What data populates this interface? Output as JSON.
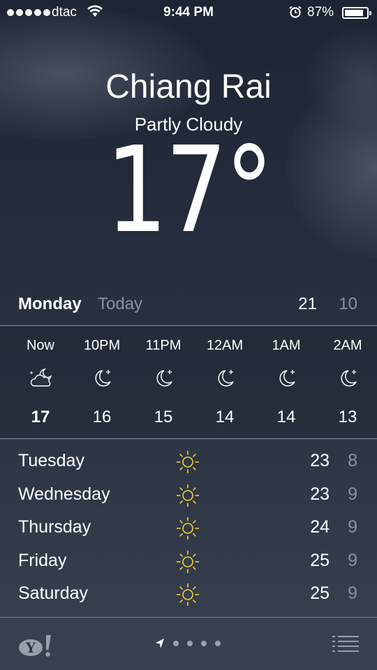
{
  "status_bar": {
    "carrier": "dtac",
    "time": "9:44 PM",
    "battery_percent": "87%",
    "battery_level": 0.87,
    "signal_bars": 5,
    "icons": [
      "wifi-icon",
      "alarm-icon",
      "battery-icon"
    ]
  },
  "location": {
    "city": "Chiang Rai",
    "condition": "Partly Cloudy",
    "temperature": "17",
    "degree_symbol": "°"
  },
  "today": {
    "day": "Monday",
    "label": "Today",
    "high": "21",
    "low": "10"
  },
  "hourly": [
    {
      "time": "Now",
      "icon": "partly-cloudy-night-icon",
      "temp": "17"
    },
    {
      "time": "10PM",
      "icon": "clear-night-icon",
      "temp": "16"
    },
    {
      "time": "11PM",
      "icon": "clear-night-icon",
      "temp": "15"
    },
    {
      "time": "12AM",
      "icon": "clear-night-icon",
      "temp": "14"
    },
    {
      "time": "1AM",
      "icon": "clear-night-icon",
      "temp": "14"
    },
    {
      "time": "2AM",
      "icon": "clear-night-icon",
      "temp": "13"
    }
  ],
  "daily": [
    {
      "day": "Tuesday",
      "icon": "sun-icon",
      "high": "23",
      "low": "8"
    },
    {
      "day": "Wednesday",
      "icon": "sun-icon",
      "high": "23",
      "low": "9"
    },
    {
      "day": "Thursday",
      "icon": "sun-icon",
      "high": "24",
      "low": "9"
    },
    {
      "day": "Friday",
      "icon": "sun-icon",
      "high": "25",
      "low": "9"
    },
    {
      "day": "Saturday",
      "icon": "sun-icon",
      "high": "25",
      "low": "9"
    }
  ],
  "toolbar": {
    "page_count": 4,
    "icons": [
      "yahoo-logo-icon",
      "location-arrow-icon",
      "list-icon"
    ]
  },
  "colors": {
    "accent_sun": "#f2d22e",
    "secondary_text": "#8a909c",
    "background_top": "#1d2433",
    "background_bottom": "#3a4252"
  }
}
